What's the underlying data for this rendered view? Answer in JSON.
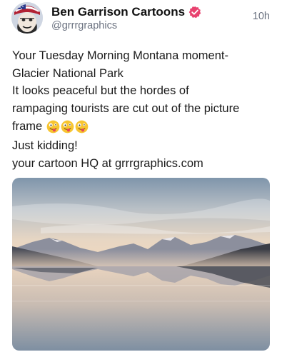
{
  "author": {
    "display_name": "Ben Garrison Cartoons",
    "handle": "@grrrgraphics",
    "avatar_icon": "cartoon-avatar",
    "verified_icon": "verified-badge-icon",
    "verified_color": "#e8426f"
  },
  "post": {
    "timestamp": "10h",
    "lines": [
      "Your Tuesday Morning Montana moment-",
      "Glacier National Park",
      "It looks peaceful but the hordes of",
      "rampaging tourists are cut out of the picture",
      "frame",
      "Just kidding!",
      "your cartoon HQ at grrrgraphics.com"
    ],
    "emojis": [
      "zany-face",
      "zany-face",
      "zany-face"
    ]
  },
  "media": {
    "description_icon": "mountain-lake-photo"
  },
  "colors": {
    "text": "#1a1a1a",
    "muted": "#6b7280",
    "background": "#ffffff"
  }
}
